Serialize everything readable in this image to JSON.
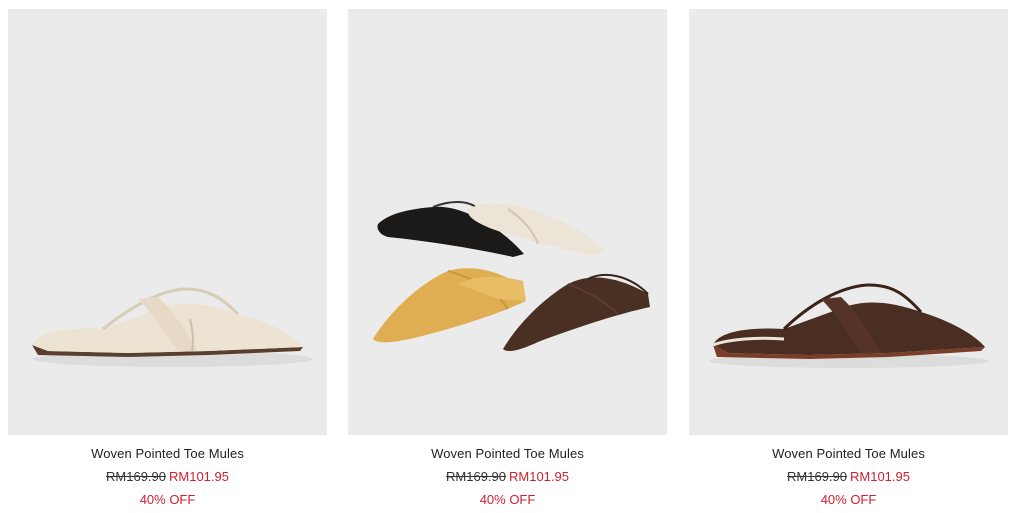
{
  "products": [
    {
      "name": "Woven Pointed Toe Mules",
      "original_price": "RM169.90",
      "sale_price": "RM101.95",
      "discount": "40% OFF",
      "image": "chalk-mule-side-view"
    },
    {
      "name": "Woven Pointed Toe Mules",
      "original_price": "RM169.90",
      "sale_price": "RM101.95",
      "discount": "40% OFF",
      "image": "four-color-mules-group"
    },
    {
      "name": "Woven Pointed Toe Mules",
      "original_price": "RM169.90",
      "sale_price": "RM101.95",
      "discount": "40% OFF",
      "image": "dark-brown-mule-side-view"
    }
  ],
  "colors": {
    "price_sale": "#d0202f",
    "image_bg": "#ebebeb"
  }
}
